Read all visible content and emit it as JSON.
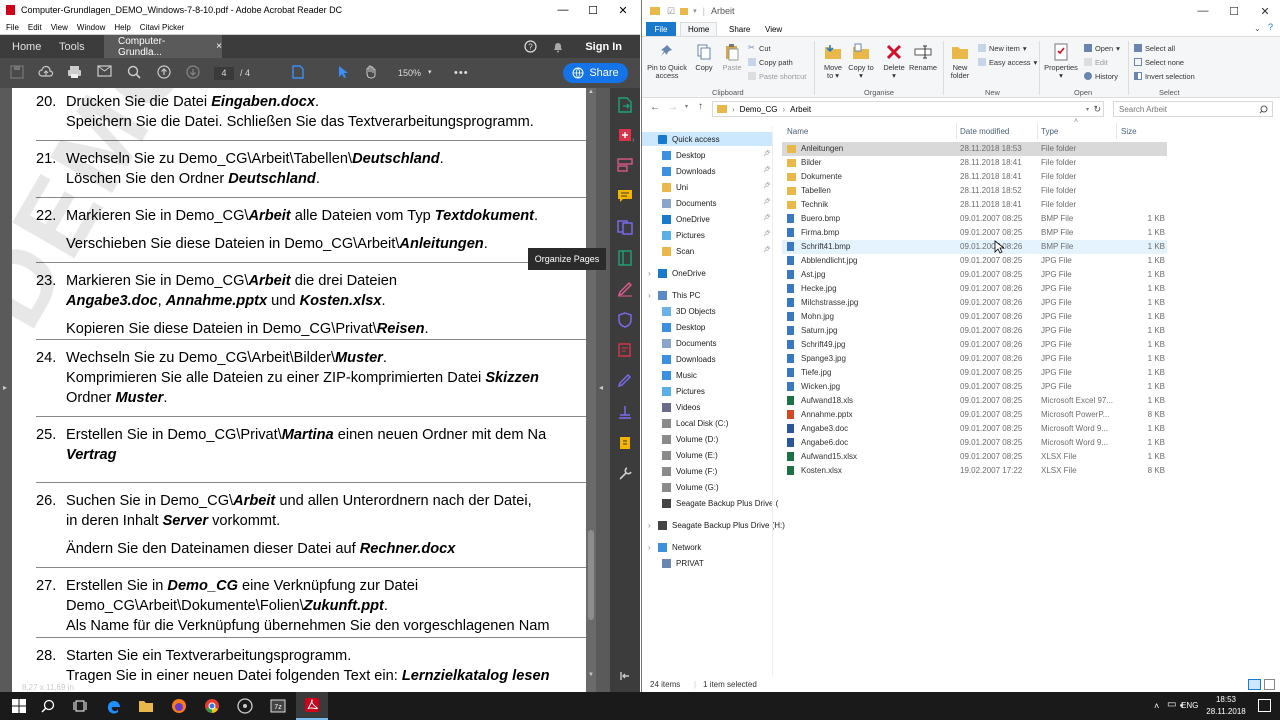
{
  "acrobat": {
    "title": "Computer-Grundlagen_DEMO_Windows-7-8-10.pdf - Adobe Acrobat Reader DC",
    "menu": [
      "File",
      "Edit",
      "View",
      "Window",
      "Help",
      "Citavi Picker"
    ],
    "tabs": {
      "home": "Home",
      "tools": "Tools",
      "document": "Computer-Grundla...",
      "close": "×",
      "signin": "Sign In"
    },
    "toolbar": {
      "page_current": "4",
      "page_total": "/ 4",
      "zoom": "150%",
      "share": "Share"
    },
    "page_size": "8,27 x 11,69 in",
    "tooltip": "Organize Pages",
    "watermark": "DEMO-TEST",
    "items": [
      {
        "num": "20.",
        "l1": [
          "Drucken Sie die Datei ",
          {
            "b": "Eingaben.docx"
          },
          "."
        ],
        "l2": [
          "Speichern Sie die Datei. Schließen Sie das Textverarbeitungsprogramm."
        ]
      },
      {
        "num": "21.",
        "l1": [
          "Wechseln Sie zu Demo_CG\\Arbeit\\Tabellen\\",
          {
            "b": "Deutschland"
          },
          "."
        ],
        "l2": [
          "Löschen Sie den Ordner ",
          {
            "b": "Deutschland"
          },
          "."
        ]
      },
      {
        "num": "22.",
        "l1": [
          "Markieren Sie in Demo_CG\\",
          {
            "b": "Arbeit"
          },
          " alle Dateien vom Typ ",
          {
            "b": "Textdokument"
          },
          "."
        ],
        "l2": [
          "Verschieben Sie diese Dateien in Demo_CG\\Arbeit\\",
          {
            "b": "Anleitungen"
          },
          "."
        ]
      },
      {
        "num": "23.",
        "l1": [
          "Markieren Sie in Demo_CG\\",
          {
            "b": "Arbeit"
          },
          " die drei Dateien"
        ],
        "l2": [
          {
            "b": "Angabe3.doc"
          },
          ", ",
          {
            "b": "Annahme.pptx"
          },
          " und ",
          {
            "b": "Kosten.xlsx"
          },
          "."
        ],
        "l3": [
          "Kopieren Sie diese Dateien in Demo_CG\\Privat\\",
          {
            "b": "Reisen"
          },
          "."
        ]
      },
      {
        "num": "24.",
        "l1": [
          "Wechseln Sie zu Demo_CG\\Arbeit\\Bilder\\",
          {
            "b": "Muster"
          },
          "."
        ],
        "l2": [
          "Komprimieren Sie alle Dateien zu einer ZIP-komprimierten Datei ",
          {
            "b": "Skizzen"
          }
        ],
        "l3": [
          "Ordner ",
          {
            "b": "Muster"
          },
          "."
        ]
      },
      {
        "num": "25.",
        "l1": [
          "Erstellen Sie in Demo_CG\\Privat\\",
          {
            "b": "Martina"
          },
          " einen neuen Ordner mit dem Na"
        ],
        "l2": [
          {
            "b": "Vertrag"
          }
        ]
      },
      {
        "num": "26.",
        "l1": [
          "Suchen Sie in Demo_CG\\",
          {
            "b": "Arbeit"
          },
          " und allen Unterordnern nach der Datei,"
        ],
        "l2": [
          "in deren Inhalt ",
          {
            "b": "Server"
          },
          " vorkommt."
        ],
        "l3": [
          "Ändern Sie den Dateinamen dieser Datei auf ",
          {
            "b": "Rechner.docx"
          }
        ]
      },
      {
        "num": "27.",
        "l1": [
          "Erstellen Sie in ",
          {
            "b": "Demo_CG"
          },
          " eine Verknüpfung zur Datei"
        ],
        "l2": [
          "Demo_CG\\Arbeit\\Dokumente\\Folien\\",
          {
            "b": "Zukunft.ppt"
          },
          "."
        ],
        "l3": [
          "Als Name für die Verknüpfung übernehmen Sie den vorgeschlagenen Nam"
        ]
      },
      {
        "num": "28.",
        "l1": [
          "Starten Sie ein Textverarbeitungsprogramm."
        ],
        "l2": [
          "Tragen Sie in einer neuen Datei folgenden Text ein: ",
          {
            "b": "Lernzielkatalog lesen"
          }
        ]
      }
    ]
  },
  "explorer": {
    "title": "Arbeit",
    "tabs": [
      "File",
      "Home",
      "Share",
      "View"
    ],
    "ribbon": {
      "pin": "Pin to Quick access",
      "copy": "Copy",
      "paste": "Paste",
      "cut": "Cut",
      "copy_path": "Copy path",
      "paste_shortcut": "Paste shortcut",
      "move_to": "Move to",
      "copy_to": "Copy to",
      "delete": "Delete",
      "rename": "Rename",
      "new_folder": "New folder",
      "new_item": "New item",
      "easy_access": "Easy access",
      "properties": "Properties",
      "open": "Open",
      "edit": "Edit",
      "history": "History",
      "select_all": "Select all",
      "select_none": "Select none",
      "invert_selection": "Invert selection",
      "groups": {
        "clipboard": "Clipboard",
        "organise": "Organise",
        "new": "New",
        "open": "Open",
        "select": "Select"
      }
    },
    "address": {
      "path1": "Demo_CG",
      "path2": "Arbeit",
      "search_placeholder": "Search Arbeit"
    },
    "columns": {
      "name": "Name",
      "date": "Date modified",
      "type": "Type",
      "size": "Size"
    },
    "nav": [
      {
        "label": "Quick access",
        "lvl": 0,
        "icon": "star",
        "pin": false
      },
      {
        "label": "Desktop",
        "lvl": 1,
        "icon": "desktop",
        "pin": true
      },
      {
        "label": "Downloads",
        "lvl": 1,
        "icon": "download",
        "pin": true
      },
      {
        "label": "Uni",
        "lvl": 1,
        "icon": "folder",
        "pin": true
      },
      {
        "label": "Documents",
        "lvl": 1,
        "icon": "docs",
        "pin": true
      },
      {
        "label": "OneDrive",
        "lvl": 1,
        "icon": "cloud",
        "pin": true
      },
      {
        "label": "Pictures",
        "lvl": 1,
        "icon": "pictures",
        "pin": true
      },
      {
        "label": "Scan",
        "lvl": 1,
        "icon": "folder",
        "pin": true
      },
      {
        "label": "OneDrive",
        "lvl": 0,
        "icon": "cloud",
        "pin": false
      },
      {
        "label": "This PC",
        "lvl": 0,
        "icon": "pc",
        "pin": false
      },
      {
        "label": "3D Objects",
        "lvl": 1,
        "icon": "folder3d",
        "pin": false
      },
      {
        "label": "Desktop",
        "lvl": 1,
        "icon": "desktop",
        "pin": false
      },
      {
        "label": "Documents",
        "lvl": 1,
        "icon": "docs",
        "pin": false
      },
      {
        "label": "Downloads",
        "lvl": 1,
        "icon": "download",
        "pin": false
      },
      {
        "label": "Music",
        "lvl": 1,
        "icon": "music",
        "pin": false
      },
      {
        "label": "Pictures",
        "lvl": 1,
        "icon": "pictures",
        "pin": false
      },
      {
        "label": "Videos",
        "lvl": 1,
        "icon": "videos",
        "pin": false
      },
      {
        "label": "Local Disk (C:)",
        "lvl": 1,
        "icon": "disk",
        "pin": false
      },
      {
        "label": "Volume (D:)",
        "lvl": 1,
        "icon": "disk",
        "pin": false
      },
      {
        "label": "Volume (E:)",
        "lvl": 1,
        "icon": "disk",
        "pin": false
      },
      {
        "label": "Volume (F:)",
        "lvl": 1,
        "icon": "disk",
        "pin": false
      },
      {
        "label": "Volume (G:)",
        "lvl": 1,
        "icon": "disk",
        "pin": false
      },
      {
        "label": "Seagate Backup Plus Drive (",
        "lvl": 1,
        "icon": "drive",
        "pin": false
      },
      {
        "label": "Seagate Backup Plus Drive (H:)",
        "lvl": 0,
        "icon": "drive",
        "pin": false
      },
      {
        "label": "Network",
        "lvl": 0,
        "icon": "network",
        "pin": false
      },
      {
        "label": "PRIVAT",
        "lvl": 1,
        "icon": "computer",
        "pin": false
      }
    ],
    "files": [
      {
        "name": "Anleitungen",
        "date": "28.11.2018 18:53",
        "type": "File folder",
        "size": "",
        "icon": "folder"
      },
      {
        "name": "Bilder",
        "date": "28.11.2018 18:41",
        "type": "File folder",
        "size": "",
        "icon": "folder"
      },
      {
        "name": "Dokumente",
        "date": "28.11.2018 18:41",
        "type": "File folder",
        "size": "",
        "icon": "folder"
      },
      {
        "name": "Tabellen",
        "date": "28.11.2018 18:52",
        "type": "File folder",
        "size": "",
        "icon": "folder"
      },
      {
        "name": "Technik",
        "date": "28.11.2018 18:41",
        "type": "File folder",
        "size": "",
        "icon": "folder"
      },
      {
        "name": "Buero.bmp",
        "date": "09.01.2007 08:25",
        "type": "BMP File",
        "size": "1 KB",
        "icon": "image"
      },
      {
        "name": "Firma.bmp",
        "date": "09.01.2007 08:25",
        "type": "BMP File",
        "size": "1 KB",
        "icon": "image"
      },
      {
        "name": "Schrift41.bmp",
        "date": "09.01.2007 08:26",
        "type": "BMP File",
        "size": "1 KB",
        "icon": "image"
      },
      {
        "name": "Abblendlicht.jpg",
        "date": "09.01.2007 08:25",
        "type": "JPG File",
        "size": "1 KB",
        "icon": "image"
      },
      {
        "name": "Ast.jpg",
        "date": "09.01.2007 08:25",
        "type": "JPG File",
        "size": "1 KB",
        "icon": "image"
      },
      {
        "name": "Hecke.jpg",
        "date": "09.01.2007 08:26",
        "type": "JPG File",
        "size": "1 KB",
        "icon": "image"
      },
      {
        "name": "Milchstrasse.jpg",
        "date": "09.01.2007 08:26",
        "type": "JPG File",
        "size": "1 KB",
        "icon": "image"
      },
      {
        "name": "Mohn.jpg",
        "date": "09.01.2007 08:26",
        "type": "JPG File",
        "size": "1 KB",
        "icon": "image"
      },
      {
        "name": "Saturn.jpg",
        "date": "09.01.2007 08:26",
        "type": "JPG File",
        "size": "1 KB",
        "icon": "image"
      },
      {
        "name": "Schrift49.jpg",
        "date": "09.01.2007 08:26",
        "type": "JPG File",
        "size": "1 KB",
        "icon": "image"
      },
      {
        "name": "Spange3.jpg",
        "date": "09.01.2007 08:26",
        "type": "JPG File",
        "size": "1 KB",
        "icon": "image"
      },
      {
        "name": "Tiefe.jpg",
        "date": "09.01.2007 08:25",
        "type": "JPG File",
        "size": "1 KB",
        "icon": "image"
      },
      {
        "name": "Wicken.jpg",
        "date": "09.01.2007 08:25",
        "type": "JPG File",
        "size": "1 KB",
        "icon": "image"
      },
      {
        "name": "Aufwand18.xls",
        "date": "09.01.2007 08:25",
        "type": "Microsoft Excel 97...",
        "size": "1 KB",
        "icon": "xls"
      },
      {
        "name": "Annahme.pptx",
        "date": "09.01.2007 08:25",
        "type": "Microsoft PowerP...",
        "size": "8 KB",
        "icon": "ppt"
      },
      {
        "name": "Angabe3.doc",
        "date": "09.01.2007 08:25",
        "type": "Microsoft Word 9...",
        "size": "1 KB",
        "icon": "doc"
      },
      {
        "name": "Angabe6.doc",
        "date": "09.01.2007 08:25",
        "type": "Microsoft Word 9...",
        "size": "1 KB",
        "icon": "doc"
      },
      {
        "name": "Aufwand15.xlsx",
        "date": "09.01.2007 08:25",
        "type": "XLSX File",
        "size": "1 KB",
        "icon": "xls"
      },
      {
        "name": "Kosten.xlsx",
        "date": "19.02.2007 17:22",
        "type": "XLSX File",
        "size": "8 KB",
        "icon": "xls"
      }
    ],
    "status": {
      "count": "24 items",
      "selected": "1 item selected"
    }
  },
  "taskbar": {
    "lang": "ENG",
    "time": "18:53",
    "date": "28.11.2018"
  },
  "colors": {
    "acrobat_dark": "#3c3c3c",
    "acrobat_blue": "#1473e6",
    "explorer_blue": "#1979ca",
    "folder": "#e8b84a",
    "selection": "#cce8ff"
  }
}
